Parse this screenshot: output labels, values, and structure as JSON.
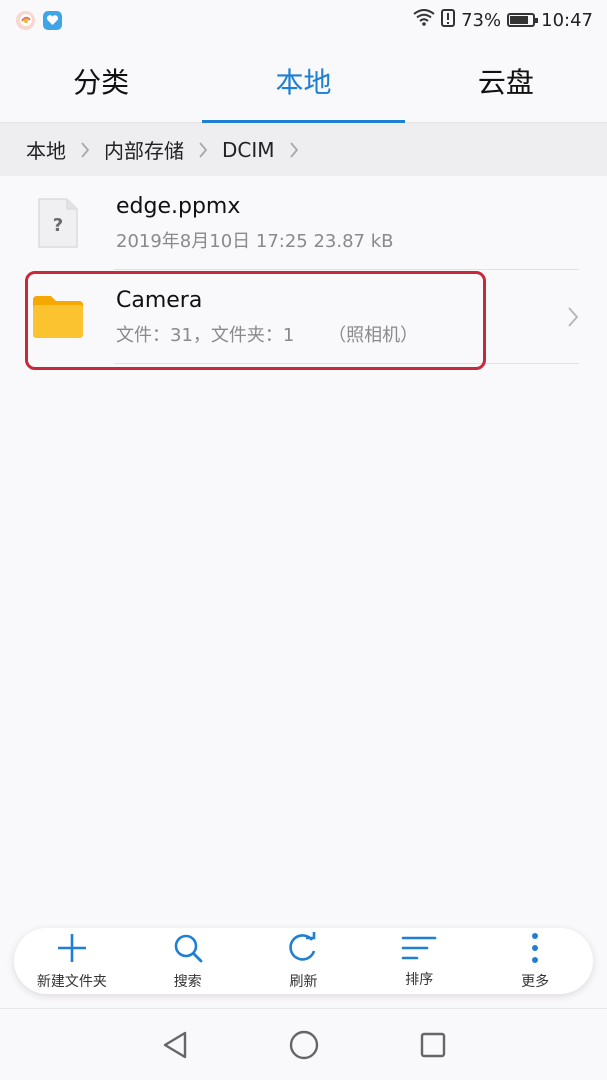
{
  "status_bar": {
    "battery_percent": "73%",
    "battery_level": 0.73,
    "time": "10:47",
    "icons": [
      "browser-notification-icon",
      "app-notification-icon",
      "wifi-icon",
      "alert-icon",
      "battery-icon"
    ]
  },
  "tabs": [
    {
      "label": "分类",
      "active": false
    },
    {
      "label": "本地",
      "active": true
    },
    {
      "label": "云盘",
      "active": false
    }
  ],
  "breadcrumb": [
    "本地",
    "内部存储",
    "DCIM"
  ],
  "files": [
    {
      "name": "edge.ppmx",
      "meta": "2019年8月10日 17:25 23.87 kB",
      "icon": "unknown-file-icon"
    },
    {
      "name": "Camera",
      "meta": "文件：31，文件夹：1",
      "alias": "（照相机）",
      "icon": "folder-icon"
    }
  ],
  "toolbar": [
    {
      "label": "新建文件夹",
      "icon": "plus-icon"
    },
    {
      "label": "搜索",
      "icon": "search-icon"
    },
    {
      "label": "刷新",
      "icon": "refresh-icon"
    },
    {
      "label": "排序",
      "icon": "sort-icon"
    },
    {
      "label": "更多",
      "icon": "more-icon"
    }
  ],
  "colors": {
    "accent": "#1f7fd2",
    "highlight": "#c8283b",
    "folder": "#fbc02d"
  }
}
